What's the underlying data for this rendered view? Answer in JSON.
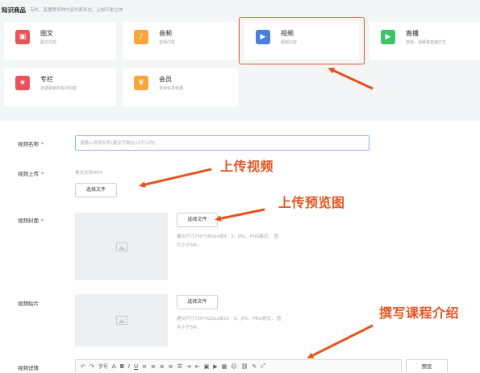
{
  "header": {
    "title": "知识商品",
    "subtitle": "专栏、直播等多种内容付费形式，让知识更立体"
  },
  "product_types": [
    {
      "title": "图文",
      "desc": "图文内容",
      "icon": "image-icon",
      "color": "#e9545b"
    },
    {
      "title": "音频",
      "desc": "音频内容",
      "icon": "audio-icon",
      "color": "#f6a63b"
    },
    {
      "title": "视频",
      "desc": "视频内容",
      "icon": "video-icon",
      "color": "#4a7fe0"
    },
    {
      "title": "直播",
      "desc": "音频、视频等直播方式",
      "icon": "live-icon",
      "color": "#3ec26a"
    },
    {
      "title": "专栏",
      "desc": "定期更新的系列内容",
      "icon": "star-icon",
      "color": "#e9545b"
    },
    {
      "title": "会员",
      "desc": "享受会员待遇",
      "icon": "crown-icon",
      "color": "#f6a63b"
    }
  ],
  "form": {
    "video_name": {
      "label": "视频名称",
      "required": "*",
      "placeholder": "请输入视频名称(建议字数在14字以内)"
    },
    "video_upload": {
      "label": "视频上传",
      "required": "*",
      "hint": "格式支持MP4",
      "button": "选择文件"
    },
    "video_cover": {
      "label": "视频封面",
      "required": "*",
      "button": "选择文件",
      "hint_line1": "建议尺寸750*560px或4：3，JPG、PNG格式，  图",
      "hint_line2": "片小于5M。"
    },
    "video_sticker": {
      "label": "视频贴片",
      "button": "选择文件",
      "hint_line1": "建议尺寸750*422px或16：9，JPG、PNG格式，  图",
      "hint_line2": "片小于5M。"
    },
    "video_detail": {
      "label": "视频详情",
      "font_label": "字号",
      "preview": "预览"
    }
  },
  "annotations": {
    "upload_video": "上传视频",
    "upload_preview": "上传预览图",
    "write_intro": "撰写课程介绍"
  },
  "accent_color": "#e5562c"
}
